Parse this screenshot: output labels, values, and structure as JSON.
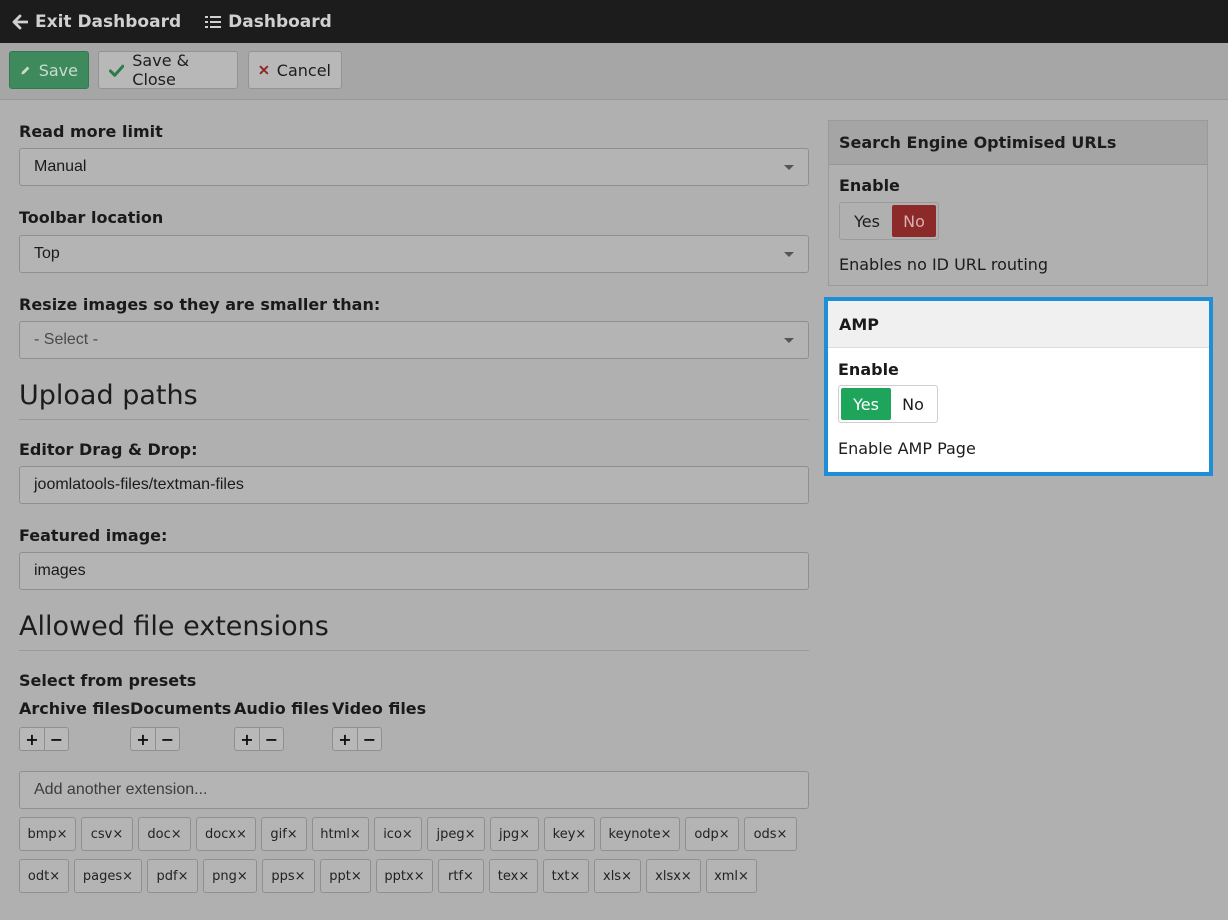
{
  "topbar": {
    "exit_label": "Exit Dashboard",
    "dashboard_label": "Dashboard"
  },
  "toolbar": {
    "save_label": "Save",
    "save_close_label": "Save & Close",
    "cancel_label": "Cancel"
  },
  "form": {
    "read_more": {
      "label": "Read more limit",
      "value": "Manual"
    },
    "toolbar_location": {
      "label": "Toolbar location",
      "value": "Top"
    },
    "resize_images": {
      "label": "Resize images so they are smaller than:",
      "value": "- Select -"
    },
    "upload_paths_heading": "Upload paths",
    "editor_dnd": {
      "label": "Editor Drag & Drop:",
      "value": "joomlatools-files/textman-files"
    },
    "featured_image": {
      "label": "Featured image:",
      "value": "images"
    },
    "allowed_ext_heading": "Allowed file extensions",
    "presets": {
      "label": "Select from presets",
      "groups": [
        "Archive files",
        "Documents",
        "Audio files",
        "Video files"
      ],
      "plus": "+",
      "minus": "−"
    },
    "add_extension_placeholder": "Add another extension...",
    "extensions": [
      "bmp×",
      "csv×",
      "doc×",
      "docx×",
      "gif×",
      "html×",
      "ico×",
      "jpeg×",
      "jpg×",
      "key×",
      "keynote×",
      "odp×",
      "ods×",
      "odt×",
      "pages×",
      "pdf×",
      "png×",
      "pps×",
      "ppt×",
      "pptx×",
      "rtf×",
      "tex×",
      "txt×",
      "xls×",
      "xlsx×",
      "xml×"
    ]
  },
  "sidebar": {
    "seo": {
      "title": "Search Engine Optimised URLs",
      "enable_label": "Enable",
      "yes": "Yes",
      "no": "No",
      "selected": "No",
      "description": "Enables no ID URL routing"
    },
    "amp": {
      "title": "AMP",
      "enable_label": "Enable",
      "yes": "Yes",
      "no": "No",
      "selected": "Yes",
      "description": "Enable AMP Page"
    }
  },
  "colors": {
    "topbar": "#1c1c1c",
    "save_green": "#3f8a5d",
    "toggle_red": "#8c2a2a",
    "toggle_green": "#1fa55b",
    "highlight_blue": "#1e8fd6"
  }
}
